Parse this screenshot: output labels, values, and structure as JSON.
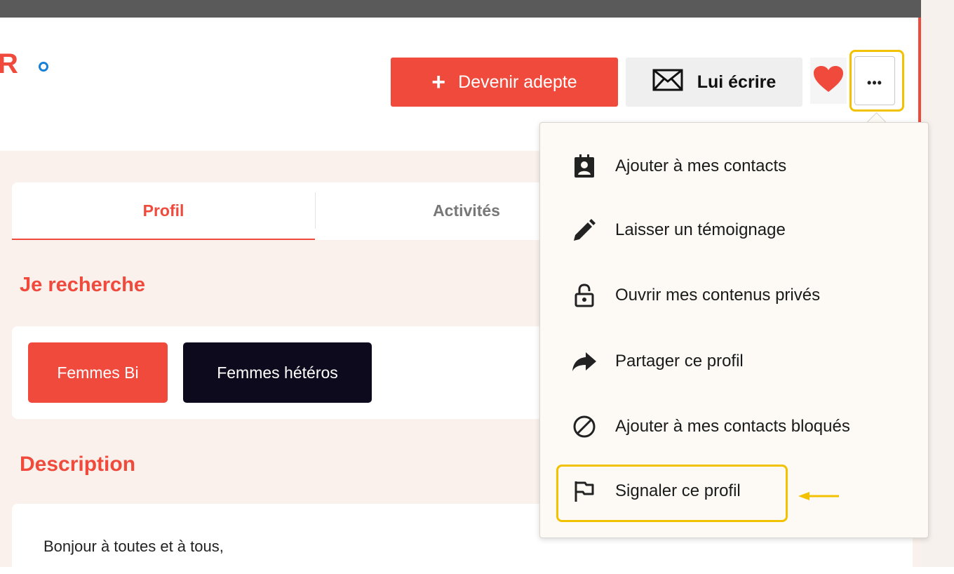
{
  "header": {
    "logo_letter": "R",
    "follow_button": "Devenir adepte",
    "follow_plus": "+",
    "message_button": "Lui écrire",
    "more_button": "•••"
  },
  "tabs": [
    {
      "label": "Profil",
      "active": true
    },
    {
      "label": "Activités",
      "active": false
    }
  ],
  "search": {
    "title": "Je recherche",
    "tags": [
      "Femmes Bi",
      "Femmes hétéros"
    ]
  },
  "description": {
    "title": "Description",
    "line1": "Bonjour à toutes et à tous,"
  },
  "menu": {
    "items": [
      {
        "label": "Ajouter à mes contacts",
        "icon": "contact-card-icon"
      },
      {
        "label": "Laisser un témoignage",
        "icon": "pencil-icon"
      },
      {
        "label": "Ouvrir mes contenus privés",
        "icon": "unlock-icon"
      },
      {
        "label": "Partager ce profil",
        "icon": "share-arrow-icon"
      },
      {
        "label": "Ajouter à mes contacts bloqués",
        "icon": "block-icon"
      },
      {
        "label": "Signaler ce profil",
        "icon": "flag-icon"
      }
    ]
  },
  "colors": {
    "accent": "#f04a3c",
    "highlight": "#f2c200",
    "dark_tag": "#0c0a1c",
    "link_blue": "#1a7fd6"
  }
}
